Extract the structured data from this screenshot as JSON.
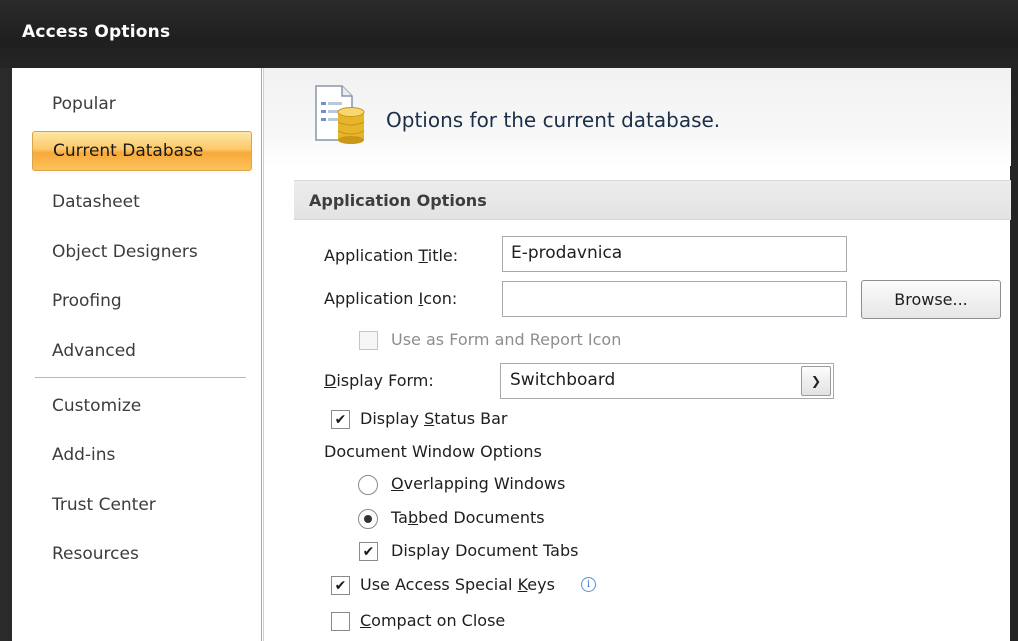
{
  "window": {
    "title": "Access Options"
  },
  "sidebar": {
    "items": [
      {
        "label": "Popular"
      },
      {
        "label": "Current Database"
      },
      {
        "label": "Datasheet"
      },
      {
        "label": "Object Designers"
      },
      {
        "label": "Proofing"
      },
      {
        "label": "Advanced"
      },
      {
        "label": "Customize"
      },
      {
        "label": "Add-ins"
      },
      {
        "label": "Trust Center"
      },
      {
        "label": "Resources"
      }
    ],
    "selected": "Current Database"
  },
  "header": {
    "text": "Options for the current database.",
    "icon": "database-icon"
  },
  "section": {
    "title": "Application Options"
  },
  "form": {
    "app_title": {
      "label_pre": "Application ",
      "label_key": "T",
      "label_post": "itle:",
      "value": "E-prodavnica"
    },
    "app_icon": {
      "label_pre": "Application ",
      "label_key": "I",
      "label_post": "con:",
      "value": ""
    },
    "browse_label": "Browse...",
    "use_as_form_icon": {
      "label": "Use as Form and Report Icon",
      "checked": false,
      "enabled": false
    },
    "display_form": {
      "label_key": "D",
      "label_post": "isplay Form:",
      "value": "Switchboard"
    },
    "display_status_bar": {
      "label_pre": "Display ",
      "label_key": "S",
      "label_post": "tatus Bar",
      "checked": true
    },
    "doc_window_options": {
      "label": "Document Window Options",
      "overlapping": {
        "label_key": "O",
        "label_post": "verlapping Windows",
        "selected": false
      },
      "tabbed": {
        "label_pre": "Ta",
        "label_key": "b",
        "label_post": "bed Documents",
        "selected": true
      },
      "display_doc_tabs": {
        "label": "Display Document Tabs",
        "checked": true
      }
    },
    "special_keys": {
      "label_pre": "Use Access Special ",
      "label_key": "K",
      "label_post": "eys",
      "checked": true
    },
    "compact_on_close": {
      "label_key": "C",
      "label_post": "ompact on Close",
      "checked": false
    }
  },
  "colors": {
    "selected_item": "#f9b347",
    "title_bar": "#232323",
    "header_text": "#1c2f48"
  }
}
